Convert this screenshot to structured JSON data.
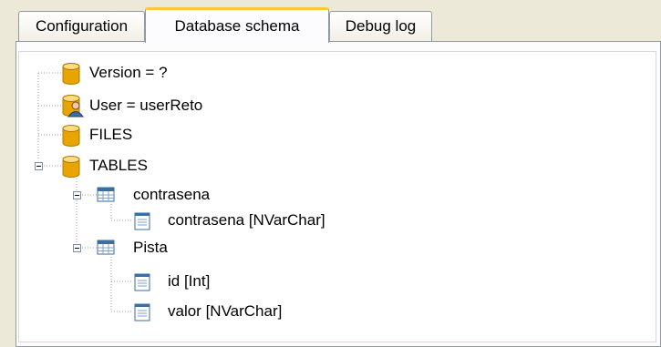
{
  "tabs": [
    {
      "label": "Configuration",
      "active": false
    },
    {
      "label": "Database schema",
      "active": true
    },
    {
      "label": "Debug log",
      "active": false
    }
  ],
  "tree": {
    "version": {
      "label": "Version = ?",
      "icon": "database-icon"
    },
    "user": {
      "label": "User = userReto",
      "icon": "database-user-icon"
    },
    "files": {
      "label": "FILES",
      "icon": "database-icon"
    },
    "tables": {
      "label": "TABLES",
      "icon": "database-icon",
      "expanded": true,
      "children": [
        {
          "label": "contrasena",
          "icon": "table-icon",
          "expanded": true,
          "columns": [
            {
              "label": "contrasena [NVarChar]",
              "icon": "column-icon"
            }
          ]
        },
        {
          "label": "Pista",
          "icon": "table-icon",
          "expanded": true,
          "columns": [
            {
              "label": "id [Int]",
              "icon": "column-icon"
            },
            {
              "label": "valor [NVarChar]",
              "icon": "column-icon"
            }
          ]
        }
      ]
    }
  },
  "colors": {
    "tab_highlight": "#ffc83c",
    "cylinder": "#e8a400",
    "table_header": "#3a6ea5",
    "tree_lines": "#a0a0a0"
  }
}
